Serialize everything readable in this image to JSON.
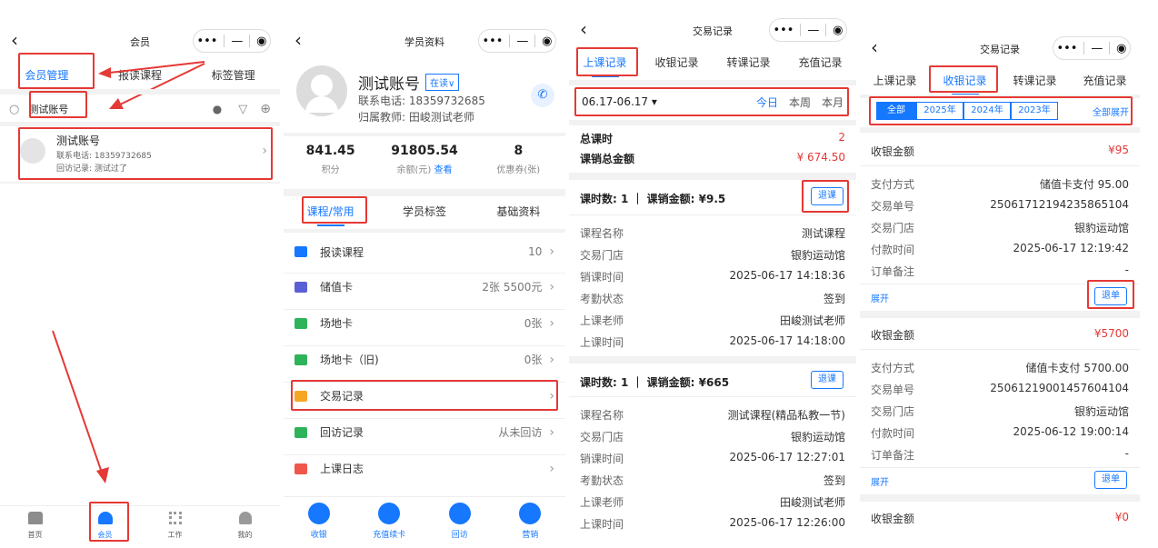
{
  "colors": {
    "accent": "#1677ff",
    "highlight": "#e53935",
    "red": "#e53935"
  },
  "p1": {
    "title": "会员",
    "tabs": [
      "会员管理",
      "报读课程",
      "标签管理"
    ],
    "search_value": "测试账号",
    "member": {
      "name": "测试账号",
      "phone": "联系电话: 18359732685",
      "visit": "回访记录: 测试过了"
    },
    "bottom_nav": [
      "首页",
      "会员",
      "工作",
      "我的"
    ]
  },
  "p2": {
    "title": "学员资料",
    "name": "测试账号",
    "status": "在读",
    "phone": "联系电话: 18359732685",
    "teacher": "归属教师: 田峻测试老师",
    "stats": [
      {
        "value": "841.45",
        "label": "积分"
      },
      {
        "value": "91805.54",
        "label": "余额(元)",
        "link": "查看"
      },
      {
        "value": "8",
        "label": "优惠券(张)"
      }
    ],
    "tabs": [
      "课程/常用",
      "学员标签",
      "基础资料"
    ],
    "menu": [
      {
        "label": "报读课程",
        "value": "10"
      },
      {
        "label": "储值卡",
        "value": "2张 5500元"
      },
      {
        "label": "场地卡",
        "value": "0张"
      },
      {
        "label": "场地卡（旧)",
        "value": "0张"
      },
      {
        "label": "交易记录",
        "value": ""
      },
      {
        "label": "回访记录",
        "value": "从未回访"
      },
      {
        "label": "上课日志",
        "value": ""
      }
    ],
    "actions": [
      "收银",
      "充值续卡",
      "回访",
      "营销"
    ]
  },
  "p3": {
    "title": "交易记录",
    "tabs": [
      "上课记录",
      "收银记录",
      "转课记录",
      "充值记录"
    ],
    "date_range": "06.17-06.17 ▾",
    "quick": [
      "今日",
      "本周",
      "本月"
    ],
    "total_hours_label": "总课时",
    "total_hours": "2",
    "total_amount_label": "课销总金额",
    "total_amount": "¥ 674.50",
    "records": [
      {
        "header": "课时数: 1 ｜ 课销金额: ¥9.5",
        "button": "退课",
        "rows": [
          [
            "课程名称",
            "测试课程"
          ],
          [
            "交易门店",
            "银豹运动馆"
          ],
          [
            "销课时间",
            "2025-06-17 14:18:36"
          ],
          [
            "考勤状态",
            "签到"
          ],
          [
            "上课老师",
            "田峻测试老师"
          ],
          [
            "上课时间",
            "2025-06-17 14:18:00"
          ]
        ]
      },
      {
        "header": "课时数: 1 ｜ 课销金额: ¥665",
        "button": "退课",
        "rows": [
          [
            "课程名称",
            "测试课程(精品私教一节)"
          ],
          [
            "交易门店",
            "银豹运动馆"
          ],
          [
            "销课时间",
            "2025-06-17 12:27:01"
          ],
          [
            "考勤状态",
            "签到"
          ],
          [
            "上课老师",
            "田峻测试老师"
          ],
          [
            "上课时间",
            "2025-06-17 12:26:00"
          ]
        ]
      }
    ]
  },
  "p4": {
    "title": "交易记录",
    "tabs": [
      "上课记录",
      "收银记录",
      "转课记录",
      "充值记录"
    ],
    "years": [
      "全部",
      "2025年",
      "2024年",
      "2023年"
    ],
    "expand_all": "全部展开",
    "records": [
      {
        "amount_label": "收银金额",
        "amount": "¥95",
        "rows": [
          [
            "支付方式",
            "储值卡支付 95.00"
          ],
          [
            "交易单号",
            "25061712194235865104"
          ],
          [
            "交易门店",
            "银豹运动馆"
          ],
          [
            "付款时间",
            "2025-06-17 12:19:42"
          ],
          [
            "订单备注",
            "-"
          ]
        ],
        "expand": "展开",
        "button": "退单"
      },
      {
        "amount_label": "收银金额",
        "amount": "¥5700",
        "rows": [
          [
            "支付方式",
            "储值卡支付 5700.00"
          ],
          [
            "交易单号",
            "25061219001457604104"
          ],
          [
            "交易门店",
            "银豹运动馆"
          ],
          [
            "付款时间",
            "2025-06-12 19:00:14"
          ],
          [
            "订单备注",
            "-"
          ]
        ],
        "expand": "展开",
        "button": "退单"
      }
    ],
    "last_amount_label": "收银金额",
    "last_amount": "¥0"
  }
}
